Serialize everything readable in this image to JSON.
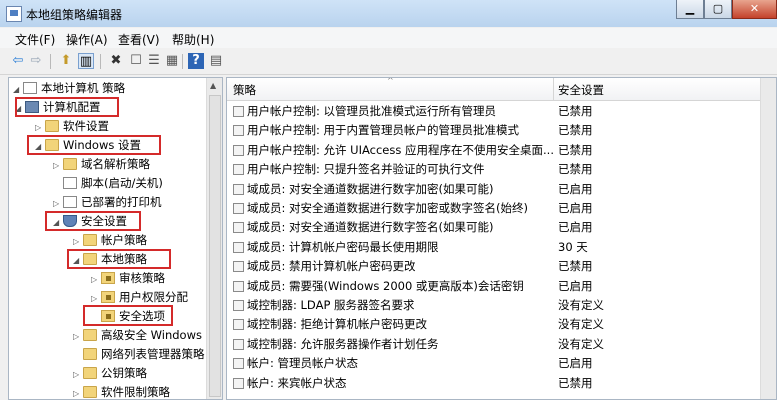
{
  "window": {
    "title": "本地组策略编辑器"
  },
  "menu": [
    "文件(F)",
    "操作(A)",
    "查看(V)",
    "帮助(H)"
  ],
  "tree": {
    "root": "本地计算机 策略",
    "computer_config": "计算机配置",
    "software_settings": "软件设置",
    "windows_settings": "Windows 设置",
    "dns_policy": "域名解析策略",
    "scripts": "脚本(启动/关机)",
    "printers": "已部署的打印机",
    "security_settings": "安全设置",
    "account_policy": "帐户策略",
    "local_policy": "本地策略",
    "audit_policy": "审核策略",
    "user_rights": "用户权限分配",
    "security_options": "安全选项",
    "advanced_firewall": "高级安全 Windows",
    "network_list": "网络列表管理器策略",
    "public_key": "公钥策略",
    "software_restriction": "软件限制策略"
  },
  "list": {
    "col_policy": "策略",
    "col_setting": "安全设置",
    "rows": [
      {
        "policy": "用户帐户控制: 以管理员批准模式运行所有管理员",
        "setting": "已禁用"
      },
      {
        "policy": "用户帐户控制: 用于内置管理员帐户的管理员批准模式",
        "setting": "已禁用"
      },
      {
        "policy": "用户帐户控制: 允许 UIAccess 应用程序在不使用安全桌面...",
        "setting": "已禁用"
      },
      {
        "policy": "用户帐户控制: 只提升签名并验证的可执行文件",
        "setting": "已禁用"
      },
      {
        "policy": "域成员: 对安全通道数据进行数字加密(如果可能)",
        "setting": "已启用"
      },
      {
        "policy": "域成员: 对安全通道数据进行数字加密或数字签名(始终)",
        "setting": "已启用"
      },
      {
        "policy": "域成员: 对安全通道数据进行数字签名(如果可能)",
        "setting": "已启用"
      },
      {
        "policy": "域成员: 计算机帐户密码最长使用期限",
        "setting": "30 天"
      },
      {
        "policy": "域成员: 禁用计算机帐户密码更改",
        "setting": "已禁用"
      },
      {
        "policy": "域成员: 需要强(Windows 2000 或更高版本)会话密钥",
        "setting": "已启用"
      },
      {
        "policy": "域控制器: LDAP 服务器签名要求",
        "setting": "没有定义"
      },
      {
        "policy": "域控制器: 拒绝计算机帐户密码更改",
        "setting": "没有定义"
      },
      {
        "policy": "域控制器: 允许服务器操作者计划任务",
        "setting": "没有定义"
      },
      {
        "policy": "帐户: 管理员帐户状态",
        "setting": "已启用"
      },
      {
        "policy": "帐户: 来宾帐户状态",
        "setting": "已禁用"
      }
    ]
  },
  "colors": {
    "highlight_box": "#d42a2a",
    "titlebar": "#c4daf2"
  }
}
